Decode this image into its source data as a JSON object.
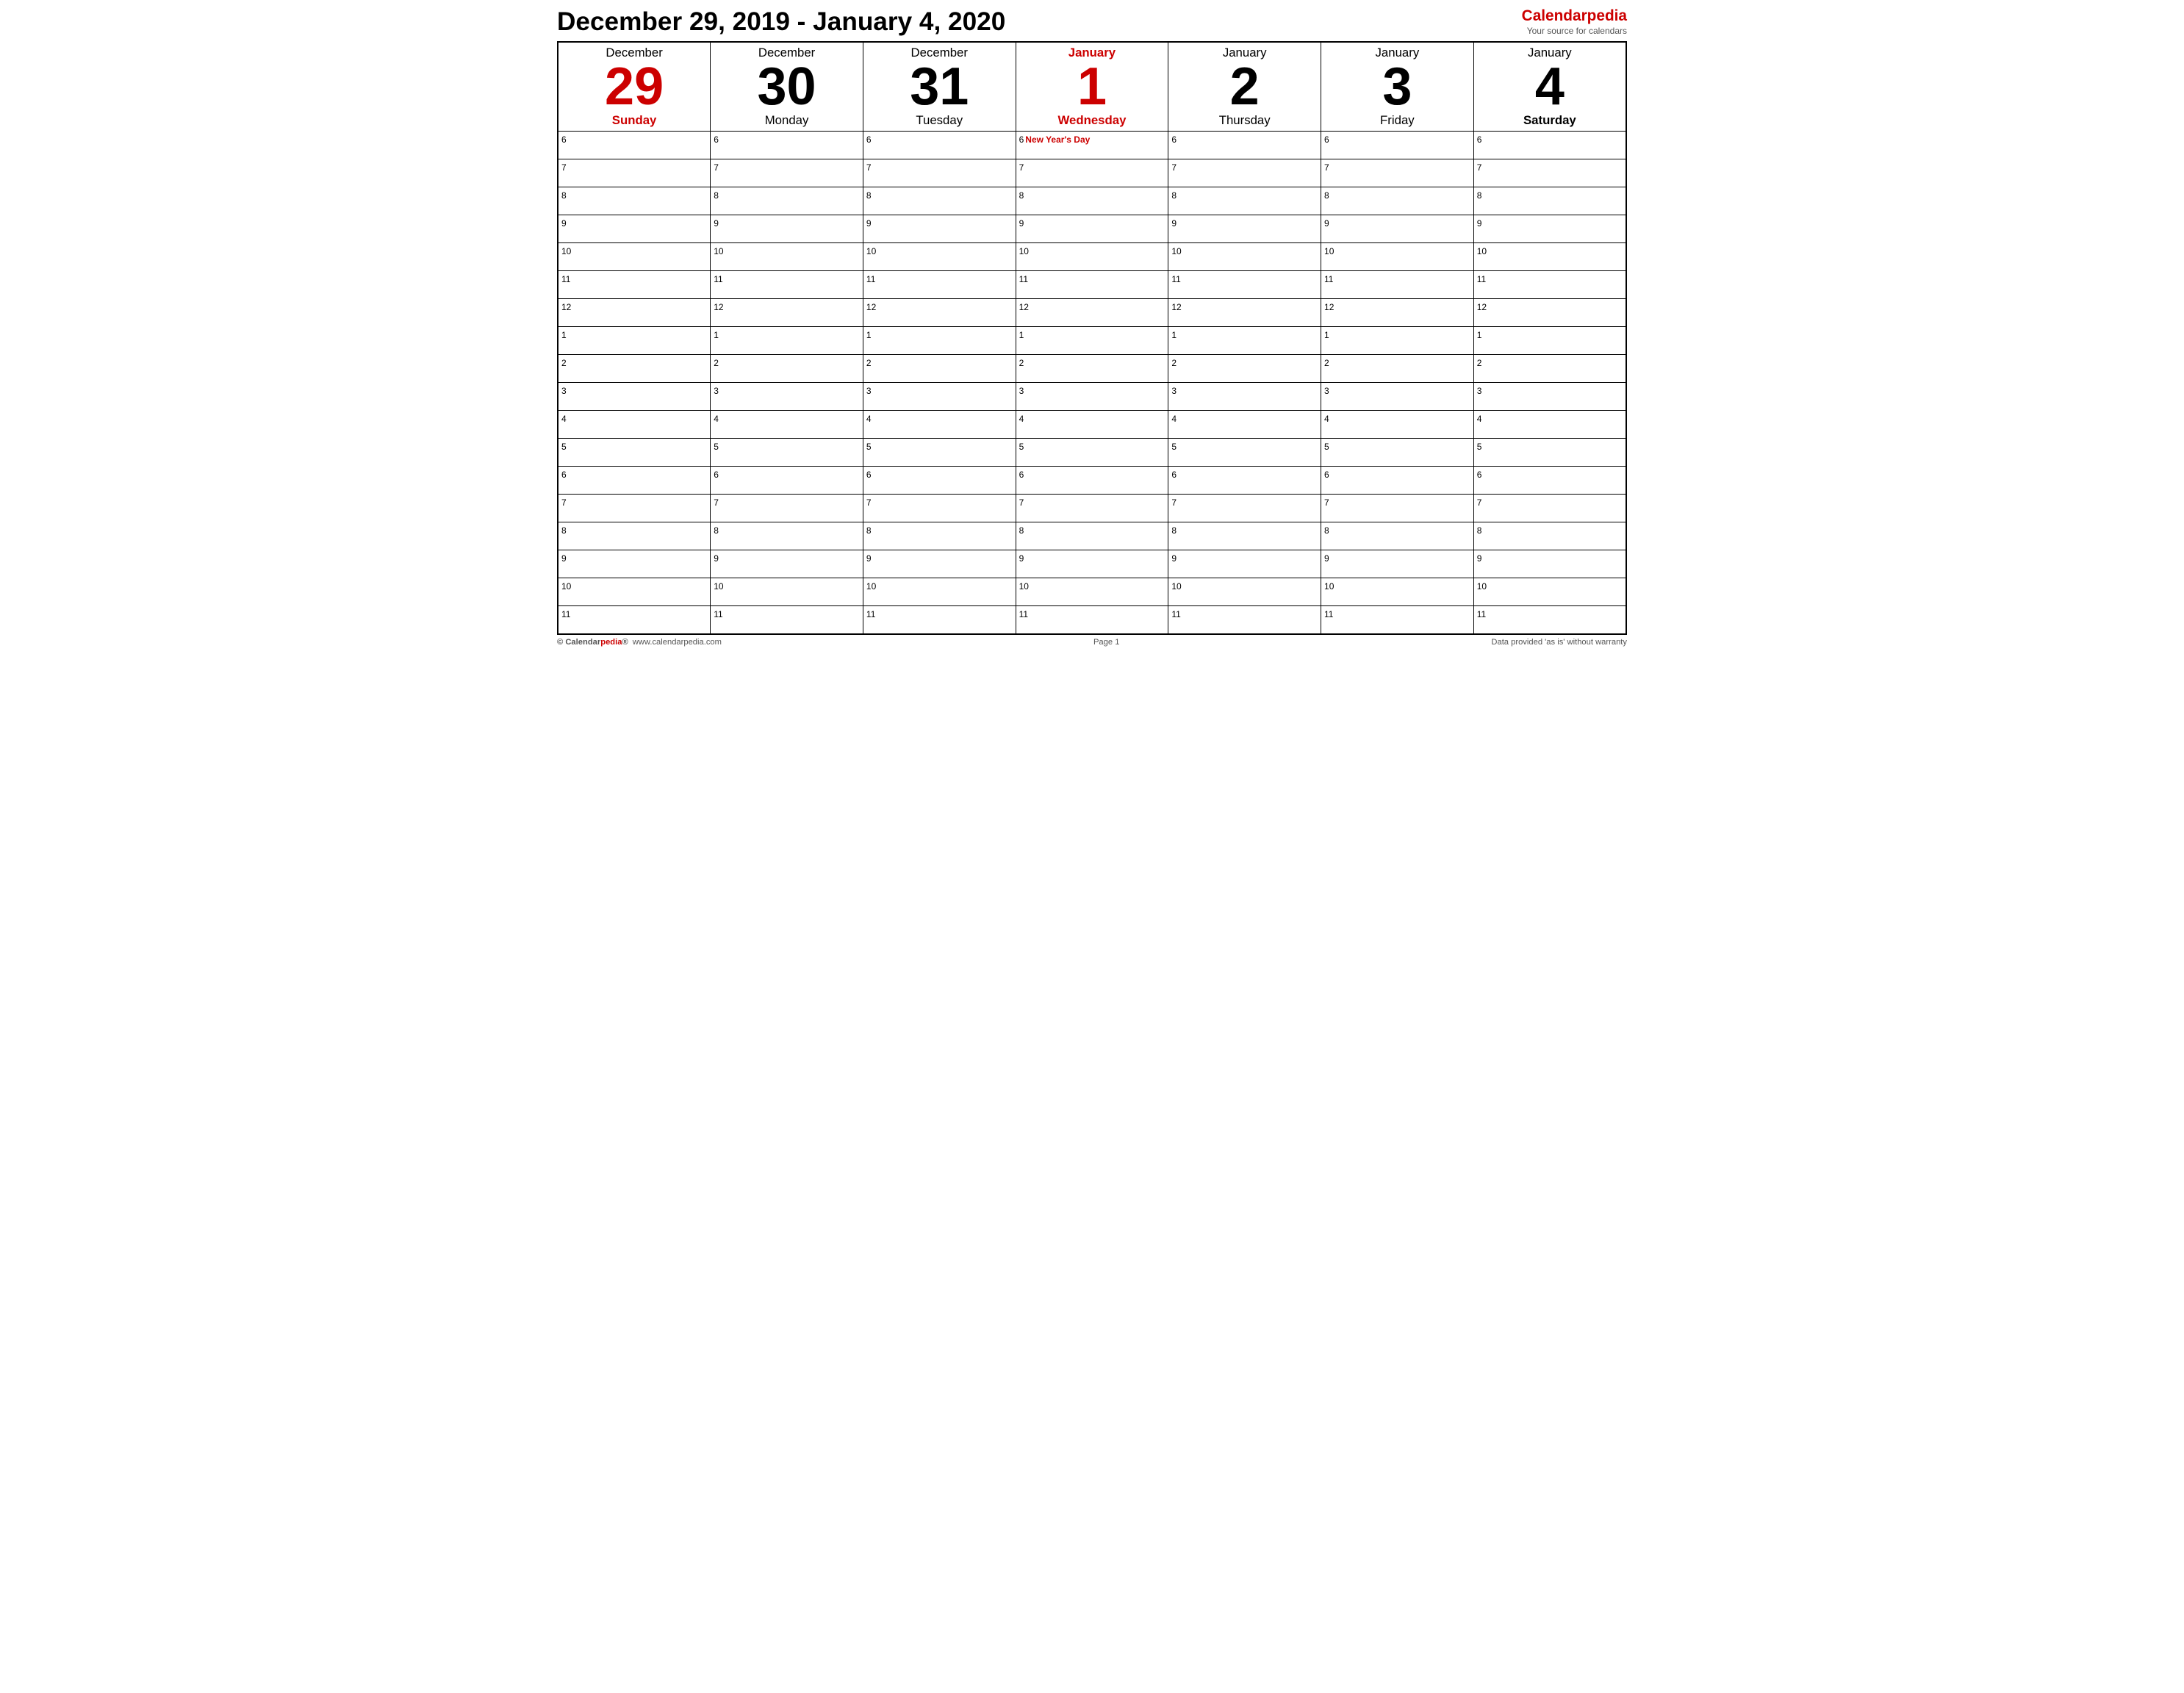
{
  "header": {
    "title": "December 29, 2019 - January 4, 2020",
    "brand_name_part1": "Calendar",
    "brand_name_part2": "pedia",
    "brand_tagline": "Your source for calendars"
  },
  "days": [
    {
      "month": "December",
      "month_color": "normal",
      "number": "29",
      "number_color": "red",
      "name": "Sunday",
      "name_style": "bold-red"
    },
    {
      "month": "December",
      "month_color": "normal",
      "number": "30",
      "number_color": "normal",
      "name": "Monday",
      "name_style": "normal"
    },
    {
      "month": "December",
      "month_color": "normal",
      "number": "31",
      "number_color": "normal",
      "name": "Tuesday",
      "name_style": "normal"
    },
    {
      "month": "January",
      "month_color": "red",
      "number": "1",
      "number_color": "red",
      "name": "Wednesday",
      "name_style": "bold-red"
    },
    {
      "month": "January",
      "month_color": "normal",
      "number": "2",
      "number_color": "normal",
      "name": "Thursday",
      "name_style": "normal"
    },
    {
      "month": "January",
      "month_color": "normal",
      "number": "3",
      "number_color": "normal",
      "name": "Friday",
      "name_style": "normal"
    },
    {
      "month": "January",
      "month_color": "normal",
      "number": "4",
      "number_color": "normal",
      "name": "Saturday",
      "name_style": "bold"
    }
  ],
  "time_slots": [
    {
      "label": "6",
      "events": [
        "",
        "",
        "",
        "New Year's Day",
        "",
        "",
        ""
      ]
    },
    {
      "label": "7",
      "events": [
        "",
        "",
        "",
        "",
        "",
        "",
        ""
      ]
    },
    {
      "label": "8",
      "events": [
        "",
        "",
        "",
        "",
        "",
        "",
        ""
      ]
    },
    {
      "label": "9",
      "events": [
        "",
        "",
        "",
        "",
        "",
        "",
        ""
      ]
    },
    {
      "label": "10",
      "events": [
        "",
        "",
        "",
        "",
        "",
        "",
        ""
      ]
    },
    {
      "label": "11",
      "events": [
        "",
        "",
        "",
        "",
        "",
        "",
        ""
      ]
    },
    {
      "label": "12",
      "events": [
        "",
        "",
        "",
        "",
        "",
        "",
        ""
      ]
    },
    {
      "label": "1",
      "events": [
        "",
        "",
        "",
        "",
        "",
        "",
        ""
      ]
    },
    {
      "label": "2",
      "events": [
        "",
        "",
        "",
        "",
        "",
        "",
        ""
      ]
    },
    {
      "label": "3",
      "events": [
        "",
        "",
        "",
        "",
        "",
        "",
        ""
      ]
    },
    {
      "label": "4",
      "events": [
        "",
        "",
        "",
        "",
        "",
        "",
        ""
      ]
    },
    {
      "label": "5",
      "events": [
        "",
        "",
        "",
        "",
        "",
        "",
        ""
      ]
    },
    {
      "label": "6",
      "events": [
        "",
        "",
        "",
        "",
        "",
        "",
        ""
      ]
    },
    {
      "label": "7",
      "events": [
        "",
        "",
        "",
        "",
        "",
        "",
        ""
      ]
    },
    {
      "label": "8",
      "events": [
        "",
        "",
        "",
        "",
        "",
        "",
        ""
      ]
    },
    {
      "label": "9",
      "events": [
        "",
        "",
        "",
        "",
        "",
        "",
        ""
      ]
    },
    {
      "label": "10",
      "events": [
        "",
        "",
        "",
        "",
        "",
        "",
        ""
      ]
    },
    {
      "label": "11",
      "events": [
        "",
        "",
        "",
        "",
        "",
        "",
        ""
      ]
    }
  ],
  "footer": {
    "copyright": "© Calendarpedia®",
    "website": "www.calendarpedia.com",
    "page": "Page 1",
    "disclaimer": "Data provided 'as is' without warranty"
  }
}
